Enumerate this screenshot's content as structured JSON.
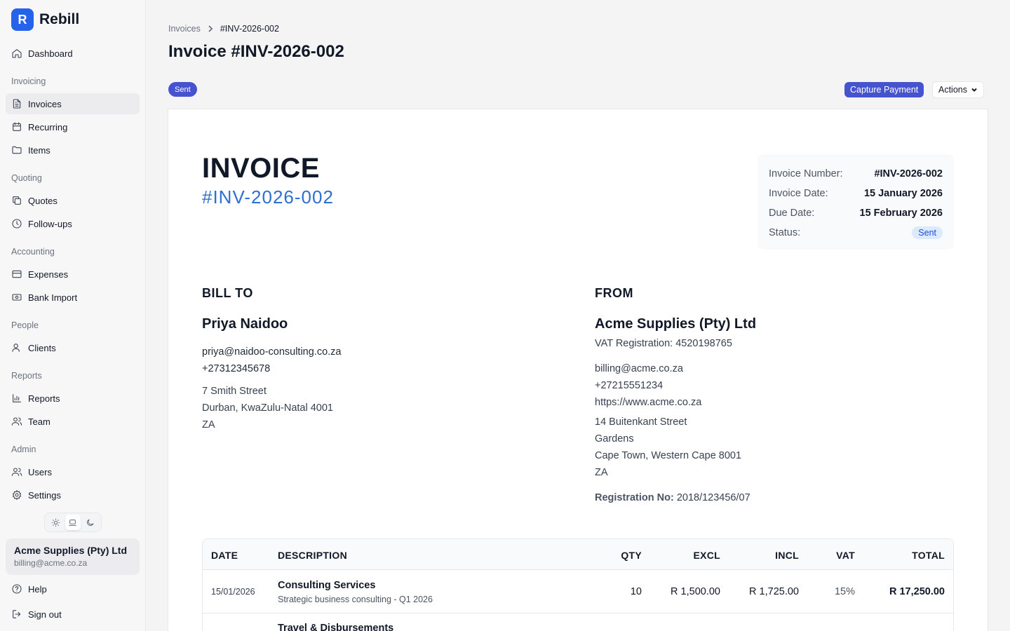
{
  "brand": {
    "logo_letter": "R",
    "name": "Rebill"
  },
  "sidebar": {
    "dashboard": "Dashboard",
    "sections": {
      "invoicing": "Invoicing",
      "quoting": "Quoting",
      "accounting": "Accounting",
      "people": "People",
      "reports": "Reports",
      "admin": "Admin"
    },
    "items": {
      "invoices": "Invoices",
      "recurring": "Recurring",
      "items": "Items",
      "quotes": "Quotes",
      "followups": "Follow-ups",
      "expenses": "Expenses",
      "bank_import": "Bank Import",
      "clients": "Clients",
      "reports": "Reports",
      "team": "Team",
      "users": "Users",
      "settings": "Settings"
    },
    "active_item": "invoices",
    "theme_modes": [
      "light",
      "system",
      "dark"
    ],
    "theme_selected": "system",
    "account": {
      "name": "Acme Supplies (Pty) Ltd",
      "email": "billing@acme.co.za"
    },
    "help": "Help",
    "sign_out": "Sign out"
  },
  "breadcrumb": {
    "parent": "Invoices",
    "current": "#INV-2026-002"
  },
  "page_title": "Invoice #INV-2026-002",
  "toolbar": {
    "status": "Sent",
    "capture_payment": "Capture Payment",
    "actions": "Actions"
  },
  "invoice": {
    "heading": "INVOICE",
    "number": "#INV-2026-002",
    "meta": {
      "number_label": "Invoice Number:",
      "number_value": "#INV-2026-002",
      "date_label": "Invoice Date:",
      "date_value": "15 January 2026",
      "due_label": "Due Date:",
      "due_value": "15 February 2026",
      "status_label": "Status:",
      "status_value": "Sent"
    },
    "bill_to": {
      "title": "BILL TO",
      "name": "Priya Naidoo",
      "email": "priya@naidoo-consulting.co.za",
      "phone": "+27312345678",
      "street": "7 Smith Street",
      "city": "Durban, KwaZulu-Natal 4001",
      "country": "ZA"
    },
    "from": {
      "title": "FROM",
      "name": "Acme Supplies (Pty) Ltd",
      "vat": "VAT Registration: 4520198765",
      "email": "billing@acme.co.za",
      "phone": "+27215551234",
      "website": "https://www.acme.co.za",
      "street": "14 Buitenkant Street",
      "suburb": "Gardens",
      "city": "Cape Town, Western Cape 8001",
      "country": "ZA",
      "registration_label": "Registration No:",
      "registration_value": "2018/123456/07"
    },
    "columns": {
      "date": "DATE",
      "description": "DESCRIPTION",
      "qty": "QTY",
      "excl": "EXCL",
      "incl": "INCL",
      "vat": "VAT",
      "total": "TOTAL"
    },
    "lines": [
      {
        "date": "15/01/2026",
        "title": "Consulting Services",
        "detail": "Strategic business consulting - Q1 2026",
        "qty": "10",
        "excl": "R 1,500.00",
        "incl": "R 1,725.00",
        "vat": "15%",
        "total": "R 17,250.00"
      },
      {
        "date": "",
        "title": "Travel & Disbursements",
        "detail": "",
        "qty": "",
        "excl": "",
        "incl": "",
        "vat": "",
        "total": ""
      }
    ]
  },
  "colors": {
    "primary": "#4653cf",
    "brand": "#2563eb",
    "accent_number": "#2f6fd1",
    "badge_bg": "#dbeafe"
  }
}
